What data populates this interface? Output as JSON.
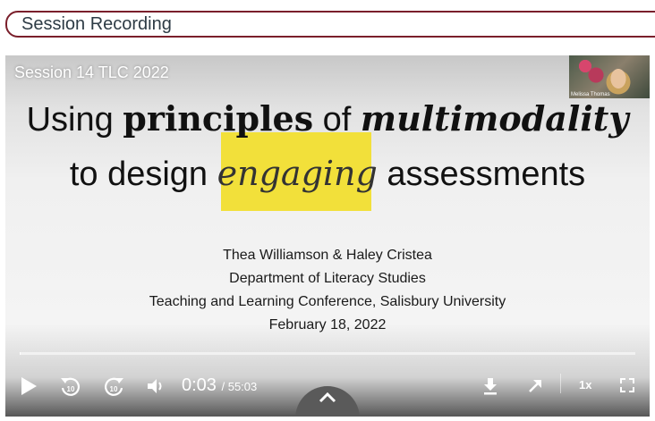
{
  "section": {
    "title": "Session Recording"
  },
  "player": {
    "video_title": "Session 14 TLC 2022",
    "camera_label": "Melissa Thomas",
    "slide": {
      "line1_a": "Using ",
      "line1_b": "principles",
      "line1_c": " of ",
      "line1_d": "multimodality",
      "line2_a": "to design ",
      "line2_b": "engaging",
      "line2_c": " assessments",
      "authors": "Thea Williamson & Haley Cristea",
      "department": "Department of Literacy Studies",
      "conference": "Teaching and Learning Conference, Salisbury University",
      "date": "February 18, 2022"
    },
    "progress": {
      "current": "0:03",
      "duration": "/ 55:03",
      "fraction": 0.001
    },
    "speed": "1x",
    "skip_back_seconds": "10",
    "skip_forward_seconds": "10",
    "icons": {
      "play": "play-icon",
      "rewind": "rewind-10-icon",
      "forward": "forward-10-icon",
      "volume": "volume-icon",
      "download": "download-icon",
      "share": "share-arrow-icon",
      "fullscreen": "fullscreen-icon",
      "expand": "chevron-up-icon"
    }
  }
}
